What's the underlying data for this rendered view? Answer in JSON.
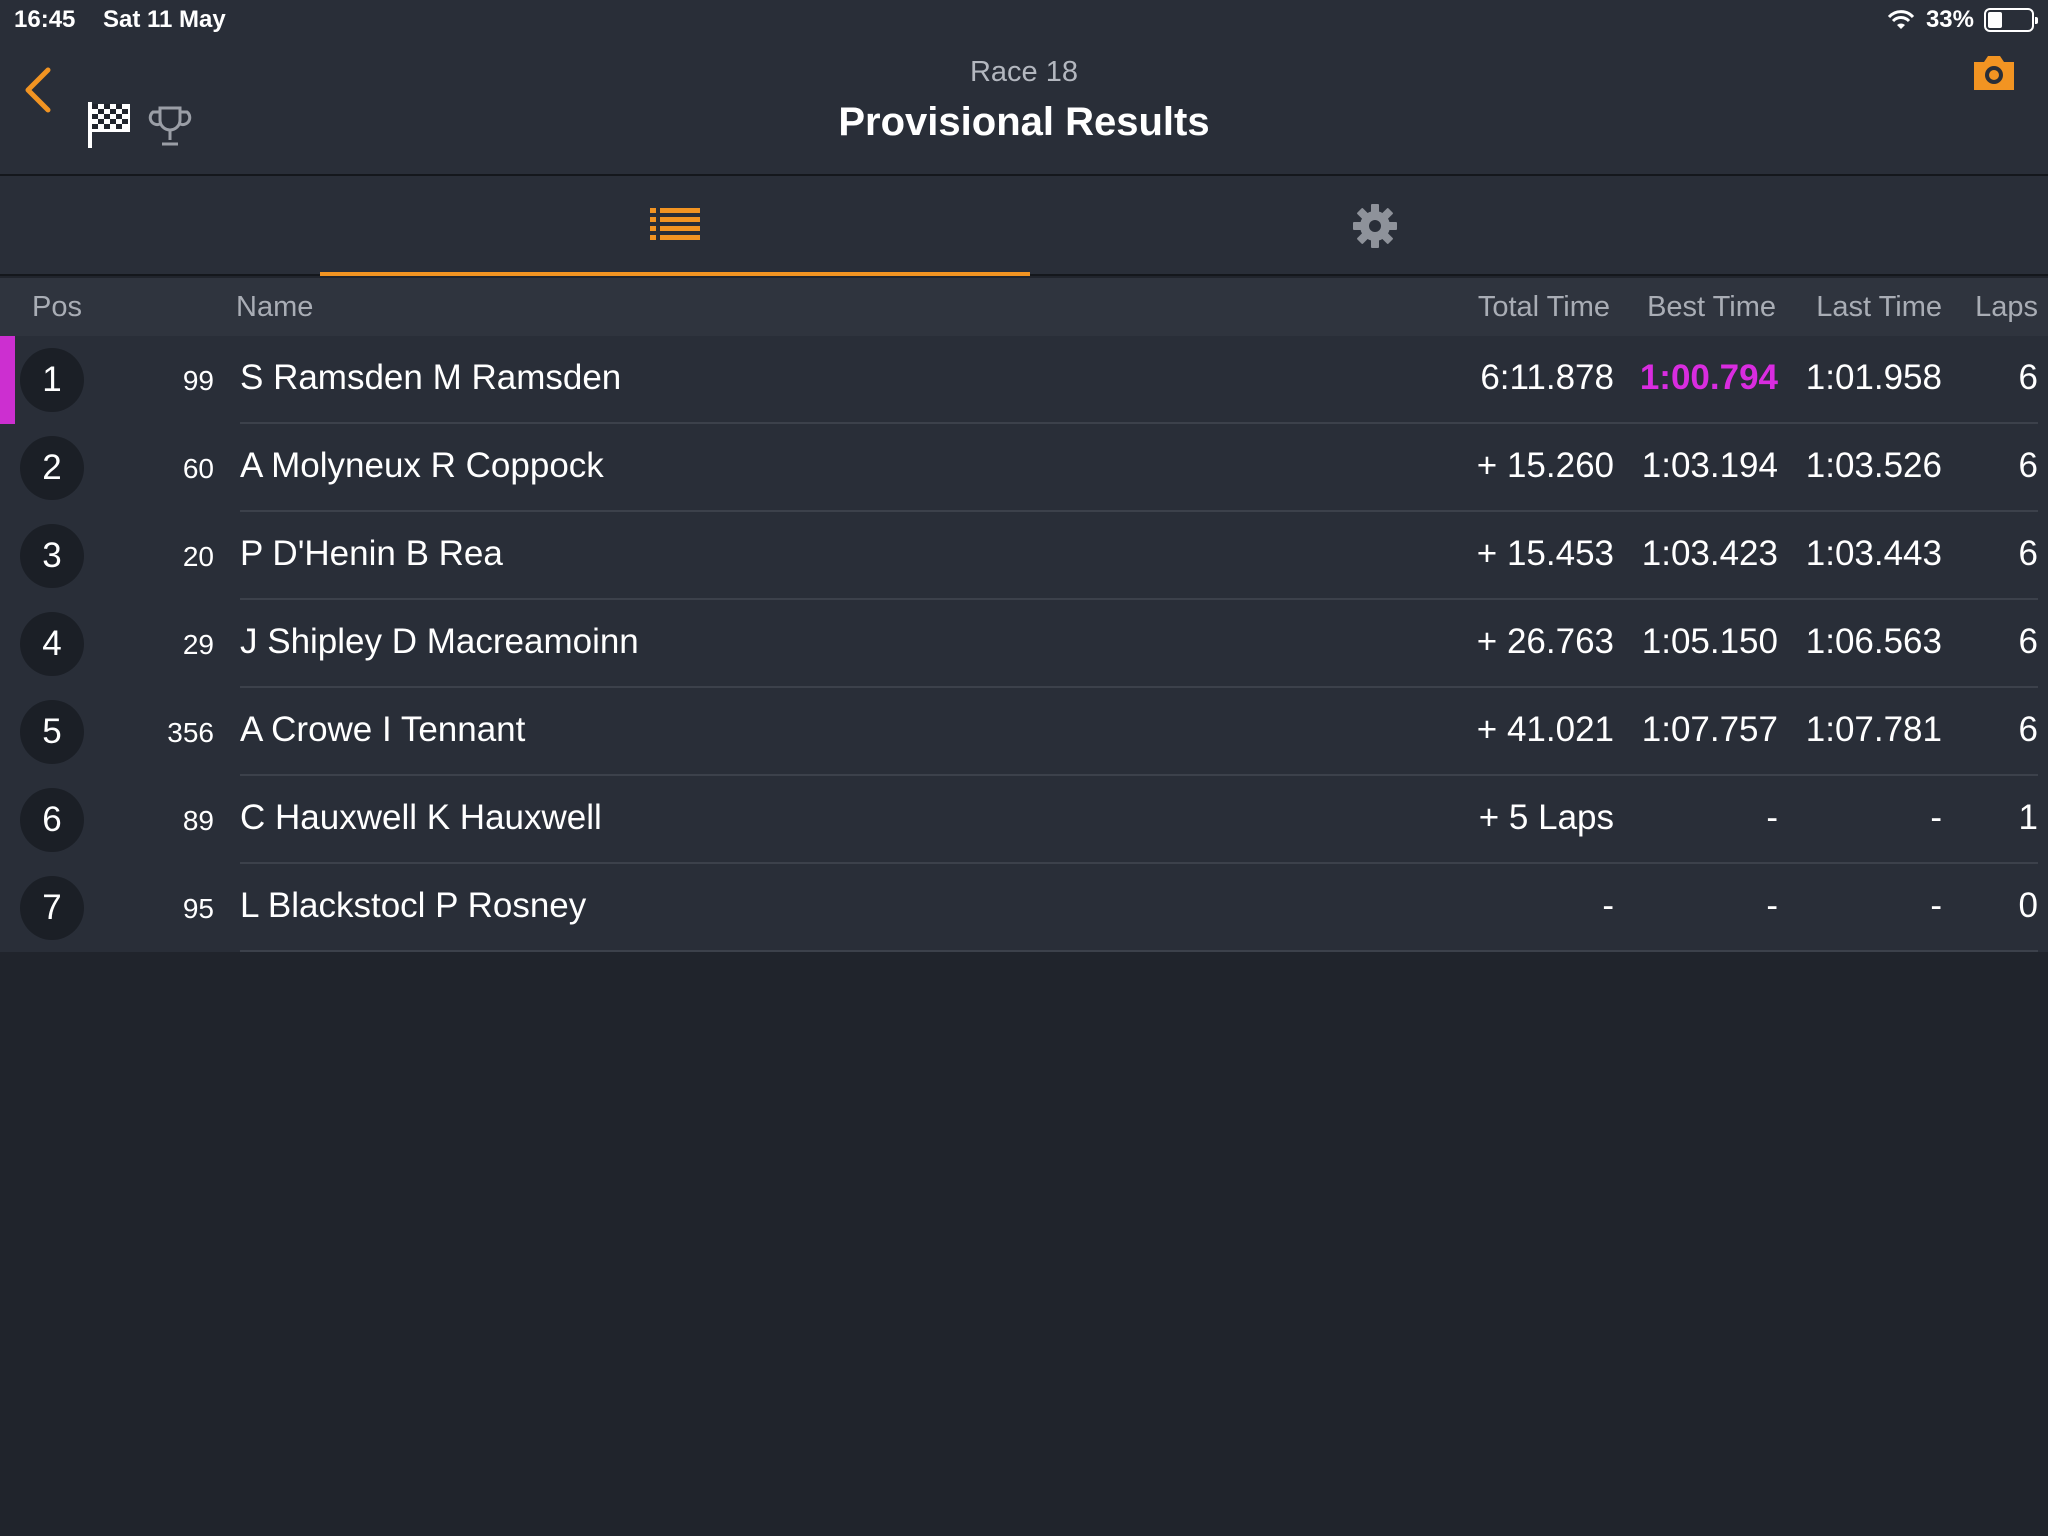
{
  "status_bar": {
    "time": "16:45",
    "date": "Sat 11 May",
    "battery_percent": "33%",
    "battery_level": 0.33
  },
  "header": {
    "subtitle": "Race 18",
    "title": "Provisional Results",
    "accent_color": "#f29422"
  },
  "tabs": [
    {
      "icon": "list-icon",
      "selected": true
    },
    {
      "icon": "gear-icon",
      "selected": false
    }
  ],
  "table": {
    "columns": {
      "pos": "Pos",
      "name": "Name",
      "total_time": "Total Time",
      "best_time": "Best Time",
      "last_time": "Last Time",
      "laps": "Laps"
    },
    "rows": [
      {
        "pos": "1",
        "number": "99",
        "name": "S Ramsden M Ramsden",
        "total_time": "6:11.878",
        "best_time": "1:00.794",
        "last_time": "1:01.958",
        "laps": "6",
        "fastest_lap": true
      },
      {
        "pos": "2",
        "number": "60",
        "name": "A Molyneux R Coppock",
        "total_time": "+ 15.260",
        "best_time": "1:03.194",
        "last_time": "1:03.526",
        "laps": "6",
        "fastest_lap": false
      },
      {
        "pos": "3",
        "number": "20",
        "name": "P D'Henin B Rea",
        "total_time": "+ 15.453",
        "best_time": "1:03.423",
        "last_time": "1:03.443",
        "laps": "6",
        "fastest_lap": false
      },
      {
        "pos": "4",
        "number": "29",
        "name": "J Shipley D Macreamoinn",
        "total_time": "+ 26.763",
        "best_time": "1:05.150",
        "last_time": "1:06.563",
        "laps": "6",
        "fastest_lap": false
      },
      {
        "pos": "5",
        "number": "356",
        "name": "A Crowe I Tennant",
        "total_time": "+ 41.021",
        "best_time": "1:07.757",
        "last_time": "1:07.781",
        "laps": "6",
        "fastest_lap": false
      },
      {
        "pos": "6",
        "number": "89",
        "name": "C Hauxwell K Hauxwell",
        "total_time": "+ 5 Laps",
        "best_time": "-",
        "last_time": "-",
        "laps": "1",
        "fastest_lap": false
      },
      {
        "pos": "7",
        "number": "95",
        "name": "L Blackstocl P Rosney",
        "total_time": "-",
        "best_time": "-",
        "last_time": "-",
        "laps": "0",
        "fastest_lap": false
      }
    ],
    "fastest_color": "#d92ce0"
  }
}
